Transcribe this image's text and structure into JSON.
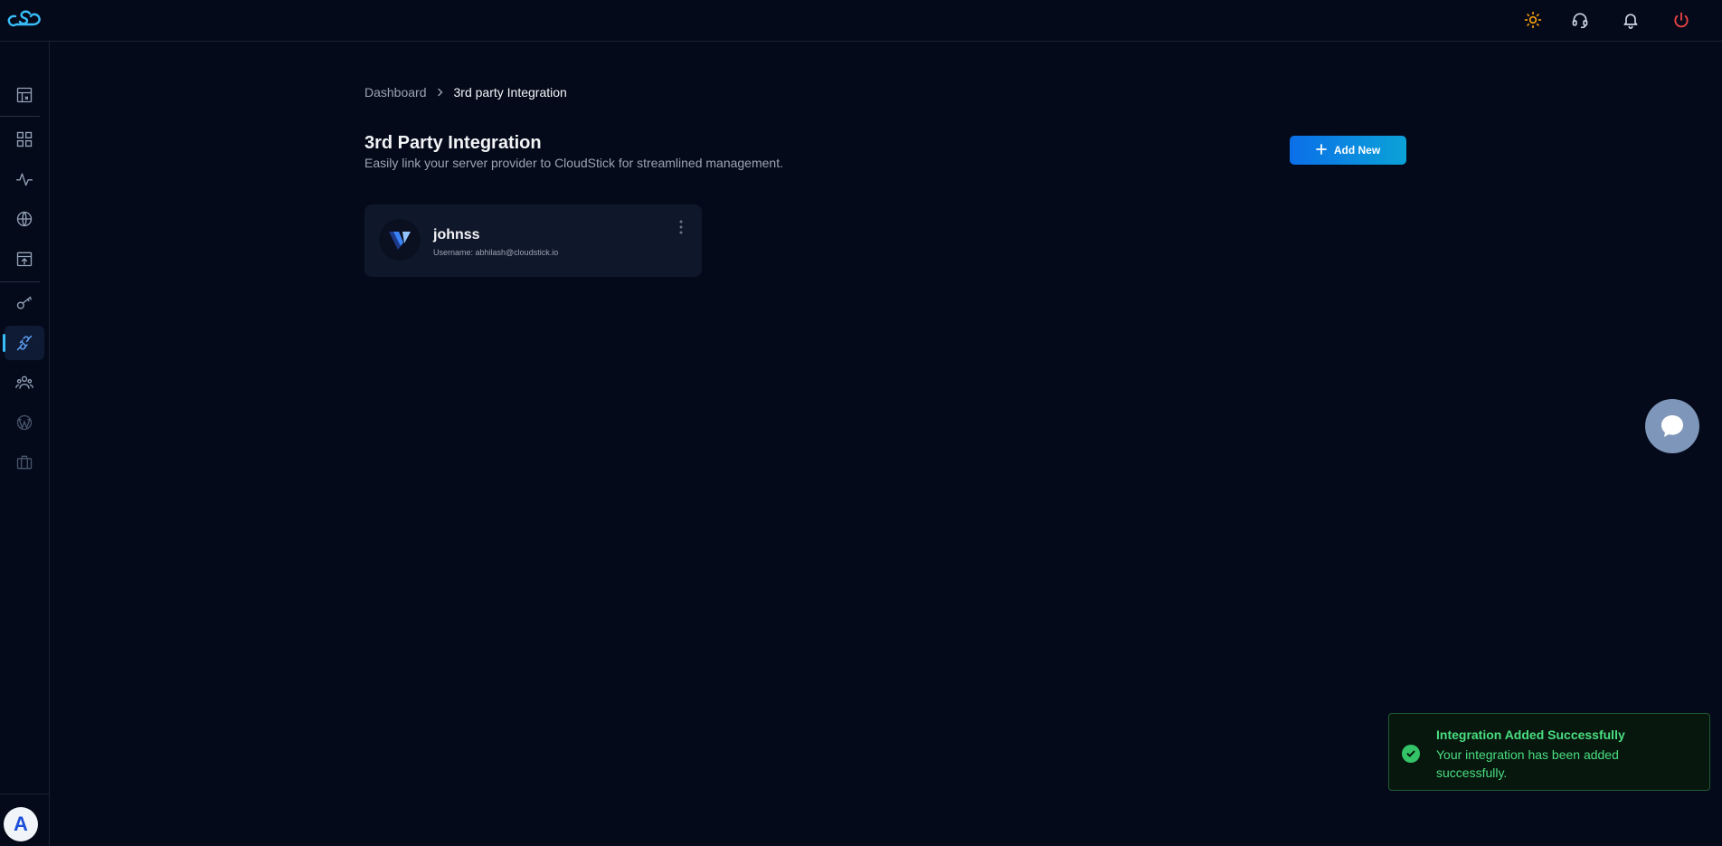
{
  "colors": {
    "background": "#050a1b",
    "accent": "#0ea5e9",
    "button_gradient_start": "#0b6fe8",
    "button_gradient_end": "#0ba2d8",
    "success": "#4ade80",
    "power": "#ef4444",
    "theme_toggle": "#f59e0b"
  },
  "topbar": {
    "logo_icon": "cloudstick-logo",
    "actions": [
      {
        "name": "theme-toggle-icon",
        "icon": "sun-icon"
      },
      {
        "name": "support-icon",
        "icon": "headset-icon"
      },
      {
        "name": "notifications-icon",
        "icon": "bell-icon"
      },
      {
        "name": "logout-icon",
        "icon": "power-icon"
      }
    ]
  },
  "sidebar": {
    "items": [
      {
        "name": "sidebar-item-dashboard",
        "icon": "layout-icon"
      },
      {
        "name": "sidebar-item-apps",
        "icon": "apps-grid-icon"
      },
      {
        "name": "sidebar-item-monitoring",
        "icon": "activity-icon"
      },
      {
        "name": "sidebar-item-domains",
        "icon": "globe-icon"
      },
      {
        "name": "sidebar-item-deploy",
        "icon": "upload-box-icon"
      },
      {
        "name": "sidebar-item-ssh-keys",
        "icon": "key-icon"
      },
      {
        "name": "sidebar-item-integrations",
        "icon": "plug-icon",
        "active": true
      },
      {
        "name": "sidebar-item-team",
        "icon": "users-icon"
      },
      {
        "name": "sidebar-item-wordpress",
        "icon": "wordpress-icon",
        "disabled": true
      },
      {
        "name": "sidebar-item-briefcase",
        "icon": "briefcase-icon",
        "disabled": true
      }
    ],
    "avatar_letter": "A"
  },
  "breadcrumb": {
    "home": "Dashboard",
    "current": "3rd party Integration"
  },
  "page": {
    "title": "3rd Party Integration",
    "subtitle": "Easily link your server provider to CloudStick for streamlined management.",
    "add_button_label": "Add New"
  },
  "integrations": [
    {
      "name": "johnss",
      "username_line": "Username: abhilash@cloudstick.io",
      "provider_icon": "vultr-logo-icon"
    }
  ],
  "chat": {
    "icon": "chat-bubble-icon"
  },
  "toast": {
    "title": "Integration Added Successfully",
    "message": "Your integration has been added successfully.",
    "icon": "check-circle-icon"
  }
}
